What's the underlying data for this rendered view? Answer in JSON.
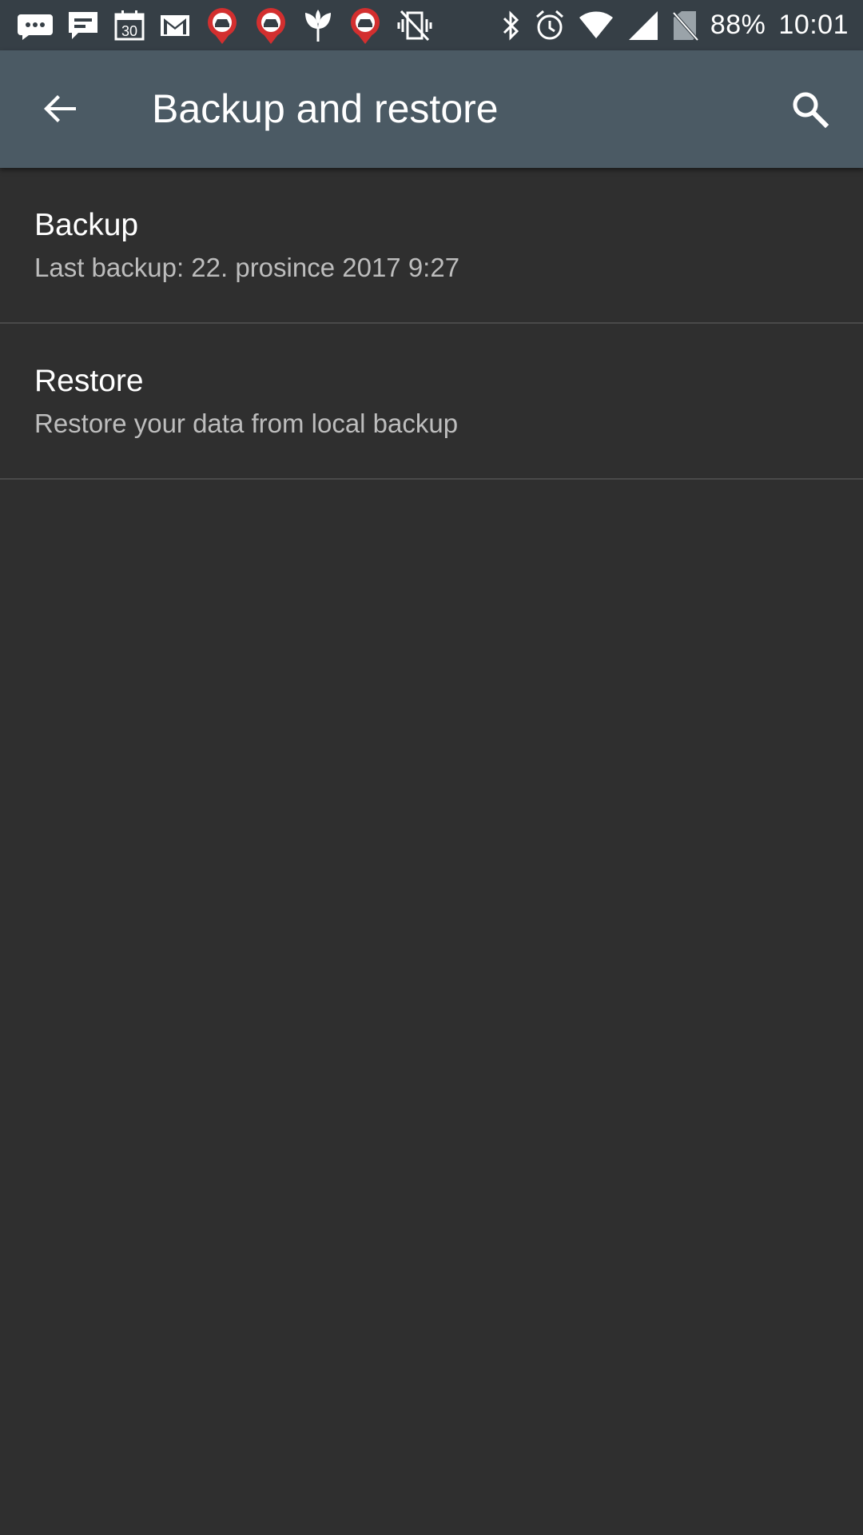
{
  "status_bar": {
    "notification_icons": [
      "messenger-icon",
      "chat-icon",
      "calendar-icon",
      "gmail-icon",
      "car-sharing-icon",
      "car-sharing-icon",
      "plant-icon",
      "car-sharing-icon",
      "vibrate-off-icon"
    ],
    "system_icons": [
      "bluetooth-icon",
      "alarm-icon",
      "wifi-icon",
      "cell-signal-icon",
      "no-sim-icon"
    ],
    "battery": "88%",
    "time": "10:01"
  },
  "app_bar": {
    "title": "Backup and restore",
    "back_icon": "arrow-back-icon",
    "search_icon": "search-icon"
  },
  "preferences": [
    {
      "title": "Backup",
      "summary": "Last backup: 22. prosince 2017 9:27"
    },
    {
      "title": "Restore",
      "summary": "Restore your data from local backup"
    }
  ],
  "colors": {
    "status_bar": "#363f46",
    "app_bar": "#4b5a64",
    "background": "#2f2f2f",
    "title_text": "#ffffff",
    "summary_text": "#bdbdbd",
    "divider": "#4a4a4a",
    "map_pin": "#d32f2f"
  }
}
